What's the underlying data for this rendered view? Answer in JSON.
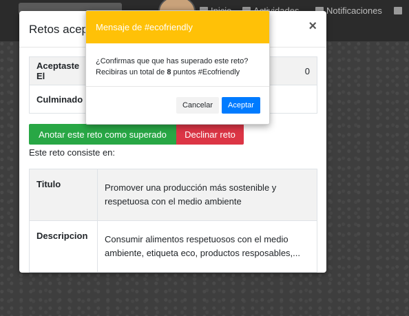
{
  "navbar": {
    "inicio_label": "Inicio",
    "second_label": "Actividades",
    "notifications_label": "Notificaciones"
  },
  "modal": {
    "title": "Retos aceptados",
    "close_symbol": "×",
    "info_rows": [
      {
        "label": "Aceptaste El",
        "value": "0"
      },
      {
        "label": "Culminado",
        "value": ""
      }
    ],
    "complete_button": "Anotar este reto como superado",
    "decline_button": "Declinar reto",
    "description_heading": "Este reto consiste en:",
    "detail_rows": [
      {
        "label": "Titulo",
        "value": "Promover una producción más sostenible y respetuosa con el medio ambiente"
      },
      {
        "label": "Descripcion",
        "value": "Consumir alimentos respetuosos con el medio ambiente, etiqueta eco, productos resposables,..."
      }
    ]
  },
  "confirm": {
    "title": "Mensaje de #ecofriendly",
    "question": "¿Confirmas que que has superado este reto?",
    "line2_prefix": "Recibiras un total de ",
    "points": "8",
    "line2_suffix": " puntos #Ecofriendly",
    "cancel_label": "Cancelar",
    "accept_label": "Aceptar"
  },
  "colors": {
    "warning_header": "#ffc107",
    "success": "#28a745",
    "danger": "#dc3545",
    "primary": "#007bff"
  }
}
